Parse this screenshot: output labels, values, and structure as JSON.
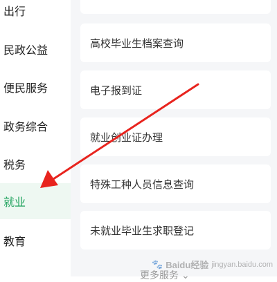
{
  "sidebar": {
    "items": [
      {
        "label": "出行"
      },
      {
        "label": "民政公益"
      },
      {
        "label": "便民服务"
      },
      {
        "label": "政务综合"
      },
      {
        "label": "税务"
      },
      {
        "label": "就业"
      },
      {
        "label": "教育"
      }
    ]
  },
  "services": {
    "items": [
      {
        "label": "高校毕业生档案查询"
      },
      {
        "label": "电子报到证"
      },
      {
        "label": "就业创业证办理"
      },
      {
        "label": "特殊工种人员信息查询"
      },
      {
        "label": "未就业毕业生求职登记"
      }
    ],
    "more_label": "更多服务"
  },
  "watermark": {
    "brand": "Baidu经验",
    "url": "jingyan.baidu.com"
  },
  "colors": {
    "active_text": "#1ba15a",
    "active_bg": "#eef8f2",
    "arrow": "#e8241e",
    "content_bg": "#f5f6f8"
  },
  "icons": {
    "more": "chevron-down-icon",
    "annotation": "red-arrow-icon"
  }
}
